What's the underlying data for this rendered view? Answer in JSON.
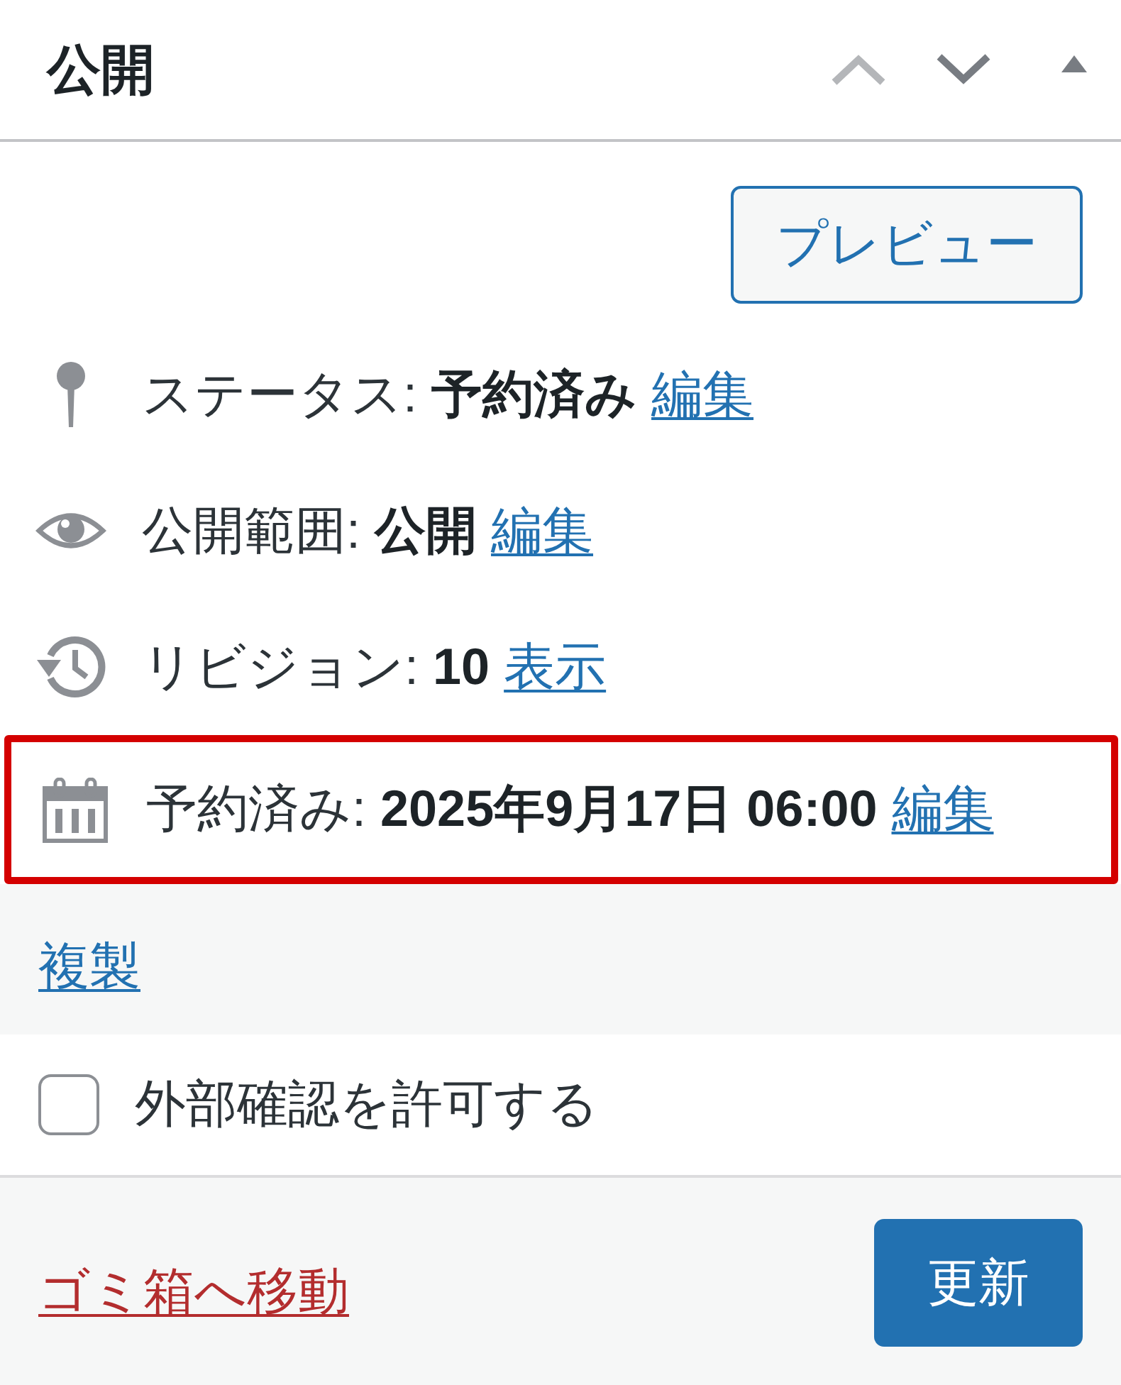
{
  "panel": {
    "title": "公開",
    "move_buttons": [
      {
        "kind": "up",
        "disabled": true
      },
      {
        "kind": "down",
        "disabled": false
      }
    ],
    "toggle": {
      "expanded": true
    }
  },
  "preview_button": "プレビュー",
  "rows": [
    {
      "kind": "status",
      "label": "ステータス:",
      "value": "予約済み",
      "link": "編集",
      "highlighted": false
    },
    {
      "kind": "visibility",
      "label": "公開範囲:",
      "value": "公開",
      "link": "編集",
      "highlighted": false
    },
    {
      "kind": "revisions",
      "label": "リビジョン:",
      "value": "10",
      "link": "表示",
      "highlighted": false
    },
    {
      "kind": "schedule",
      "label": "予約済み:",
      "value": "2025年9月17日 06:00",
      "link": "編集",
      "highlighted": true
    }
  ],
  "duplicate_link": "複製",
  "checkbox": {
    "label": "外部確認を許可する",
    "checked": false
  },
  "footer": {
    "trash_link": "ゴミ箱へ移動",
    "update_button": "更新"
  }
}
